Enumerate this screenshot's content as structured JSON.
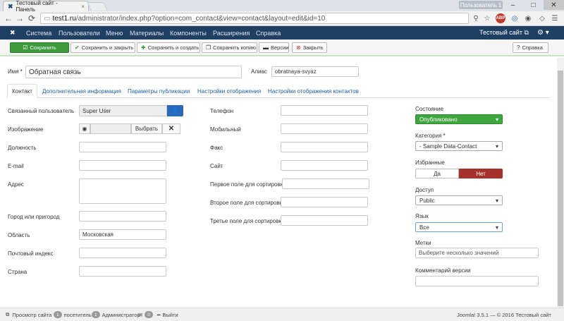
{
  "browser": {
    "tab_title": "Тестовый сайт - Панель",
    "user_badge": "Пользователь 1",
    "url_prefix": "test1.ru",
    "url_rest": "/administrator/index.php?option=com_contact&view=contact&layout=edit&id=10",
    "back": "←",
    "forward": "→",
    "reload": "⟳",
    "ext_abp": "ABP",
    "min": "–",
    "max": "□",
    "close": "✕"
  },
  "admin_menu": {
    "logo": "✖",
    "items": [
      "Система",
      "Пользователи",
      "Меню",
      "Материалы",
      "Компоненты",
      "Расширения",
      "Справка"
    ],
    "site_title": "Тестовый сайт ⧉",
    "gear": "⚙ ▾"
  },
  "actions": {
    "save": "Сохранить",
    "save_close": "Сохранить и закрыть",
    "save_new": "Сохранить и создать",
    "save_copy": "Сохранить копию",
    "versions": "Версии",
    "close": "Закрыть",
    "help": "Справка"
  },
  "header_fields": {
    "name_label": "Имя *",
    "name_value": "Обратная связь",
    "alias_label": "Алиас",
    "alias_value": "obratnaya-svyaz"
  },
  "tabs": [
    "Контакт",
    "Дополнительная информация",
    "Параметры публикации",
    "Настройки отображения",
    "Настройки отображения контактов"
  ],
  "left_col": {
    "linked_user_label": "Связанный пользователь",
    "linked_user_value": "Super User",
    "image_label": "Изображение",
    "image_select": "Выбрать",
    "position_label": "Должность",
    "email_label": "E-mail",
    "address_label": "Адрес",
    "city_label": "Город или пригород",
    "region_label": "Область",
    "region_value": "Московская",
    "zip_label": "Почтовый индекс",
    "country_label": "Страна"
  },
  "mid_col": {
    "phone_label": "Телефон",
    "mobile_label": "Мобильный",
    "fax_label": "Факс",
    "site_label": "Сайт",
    "sort1_label": "Первое поле для сортировки",
    "sort2_label": "Второе поле для сортировки",
    "sort3_label": "Третье поле для сортировки"
  },
  "right_col": {
    "state_label": "Состояние",
    "state_value": "Опубликовано",
    "category_label": "Категория *",
    "category_value": "- Sample Data-Contact",
    "featured_label": "Избранные",
    "featured_yes": "Да",
    "featured_no": "Нет",
    "access_label": "Доступ",
    "access_value": "Public",
    "language_label": "Язык",
    "language_value": "Все",
    "tags_label": "Метки",
    "tags_placeholder": "Выберите несколько значений",
    "version_note_label": "Комментарий версии"
  },
  "status_bar": {
    "view_site": "Просмотр сайта",
    "visitors_count": "1",
    "visitors_label": "посетитель",
    "admins_count": "1",
    "admins_label": "Администратор",
    "messages_count": "0",
    "logout": "Выйти",
    "footer": "Joomla! 3.5.1 — © 2016 Тестовый сайт"
  },
  "colors": {
    "admin_bar": "#1f3f63",
    "save_green": "#3c9a3c",
    "published_green": "#3fa53f",
    "featured_no_red": "#a6312b"
  }
}
